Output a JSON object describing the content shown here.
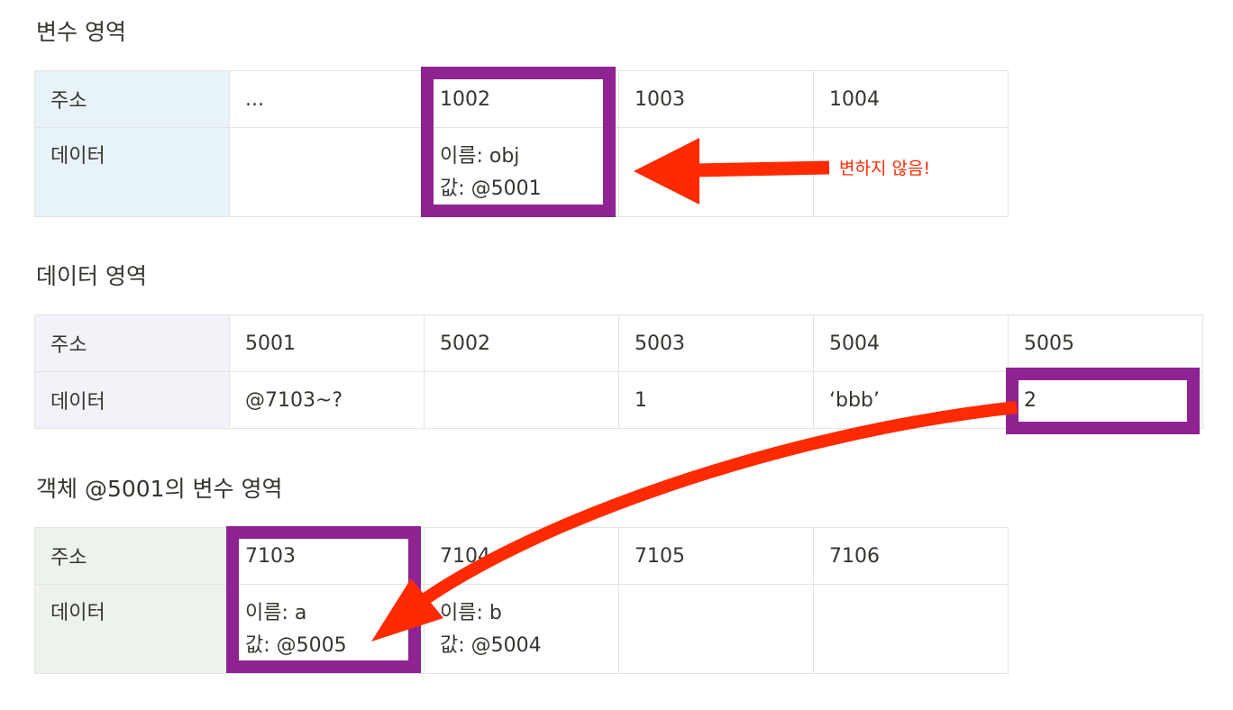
{
  "sections": {
    "variables": {
      "title": "변수 영역",
      "address_label": "주소",
      "data_label": "데이터",
      "addresses": [
        "...",
        "1002",
        "1003",
        "1004"
      ],
      "data": [
        [],
        [
          "이름: obj",
          "값: @5001"
        ],
        [],
        []
      ]
    },
    "data_area": {
      "title": "데이터 영역",
      "address_label": "주소",
      "data_label": "데이터",
      "addresses": [
        "5001",
        "5002",
        "5003",
        "5004",
        "5005"
      ],
      "data": [
        "@7103~?",
        "",
        "1",
        "‘bbb’",
        "2"
      ]
    },
    "object_vars": {
      "title": "객체 @5001의 변수 영역",
      "address_label": "주소",
      "data_label": "데이터",
      "addresses": [
        "7103",
        "7104",
        "7105",
        "7106"
      ],
      "data": [
        [
          "이름: a",
          "값: @5005"
        ],
        [
          "이름: b",
          "값: @5004"
        ],
        [],
        []
      ]
    }
  },
  "annotation": {
    "note": "변하지 않음!",
    "highlight_color": "#8e2391",
    "arrow_color": "#ff2a00"
  }
}
